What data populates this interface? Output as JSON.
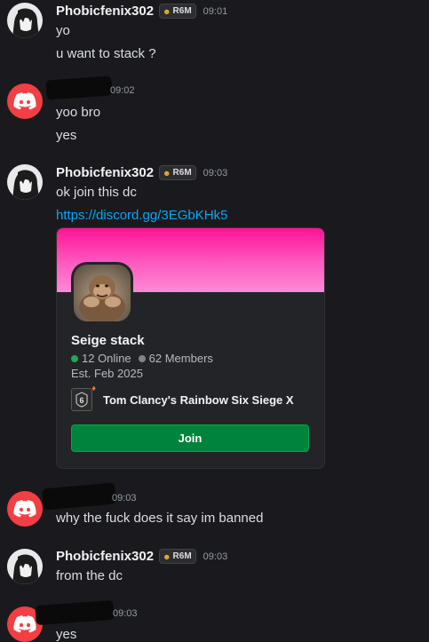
{
  "messages": [
    {
      "author": "Phobicfenix302",
      "tag": "R6M",
      "time": "09:01",
      "lines": [
        "yo",
        "u want to stack ?"
      ]
    },
    {
      "author_redacted": true,
      "time": "09:02",
      "lines": [
        "yoo bro",
        "yes"
      ]
    },
    {
      "author": "Phobicfenix302",
      "tag": "R6M",
      "time": "09:03",
      "lines": [
        "ok join this dc"
      ],
      "link": "https://discord.gg/3EGbKHk5"
    },
    {
      "author_redacted": true,
      "time": "09:03",
      "lines": [
        "why the fuck does it say im banned"
      ]
    },
    {
      "author": "Phobicfenix302",
      "tag": "R6M",
      "time": "09:03",
      "lines": [
        "from the dc"
      ]
    },
    {
      "author_redacted": true,
      "time": "09:03",
      "lines": [
        "yes"
      ]
    }
  ],
  "invite": {
    "server_name": "Seige stack",
    "online": "12 Online",
    "members": "62 Members",
    "established": "Est. Feb 2025",
    "game": "Tom Clancy's Rainbow Six Siege X",
    "join_label": "Join",
    "banner_color": "#ff1493"
  },
  "colors": {
    "background": "#1a1a1e",
    "link": "#00a8fc",
    "join_button": "#00843d",
    "online_dot": "#23a55a",
    "discord_avatar": "#f23f43"
  }
}
